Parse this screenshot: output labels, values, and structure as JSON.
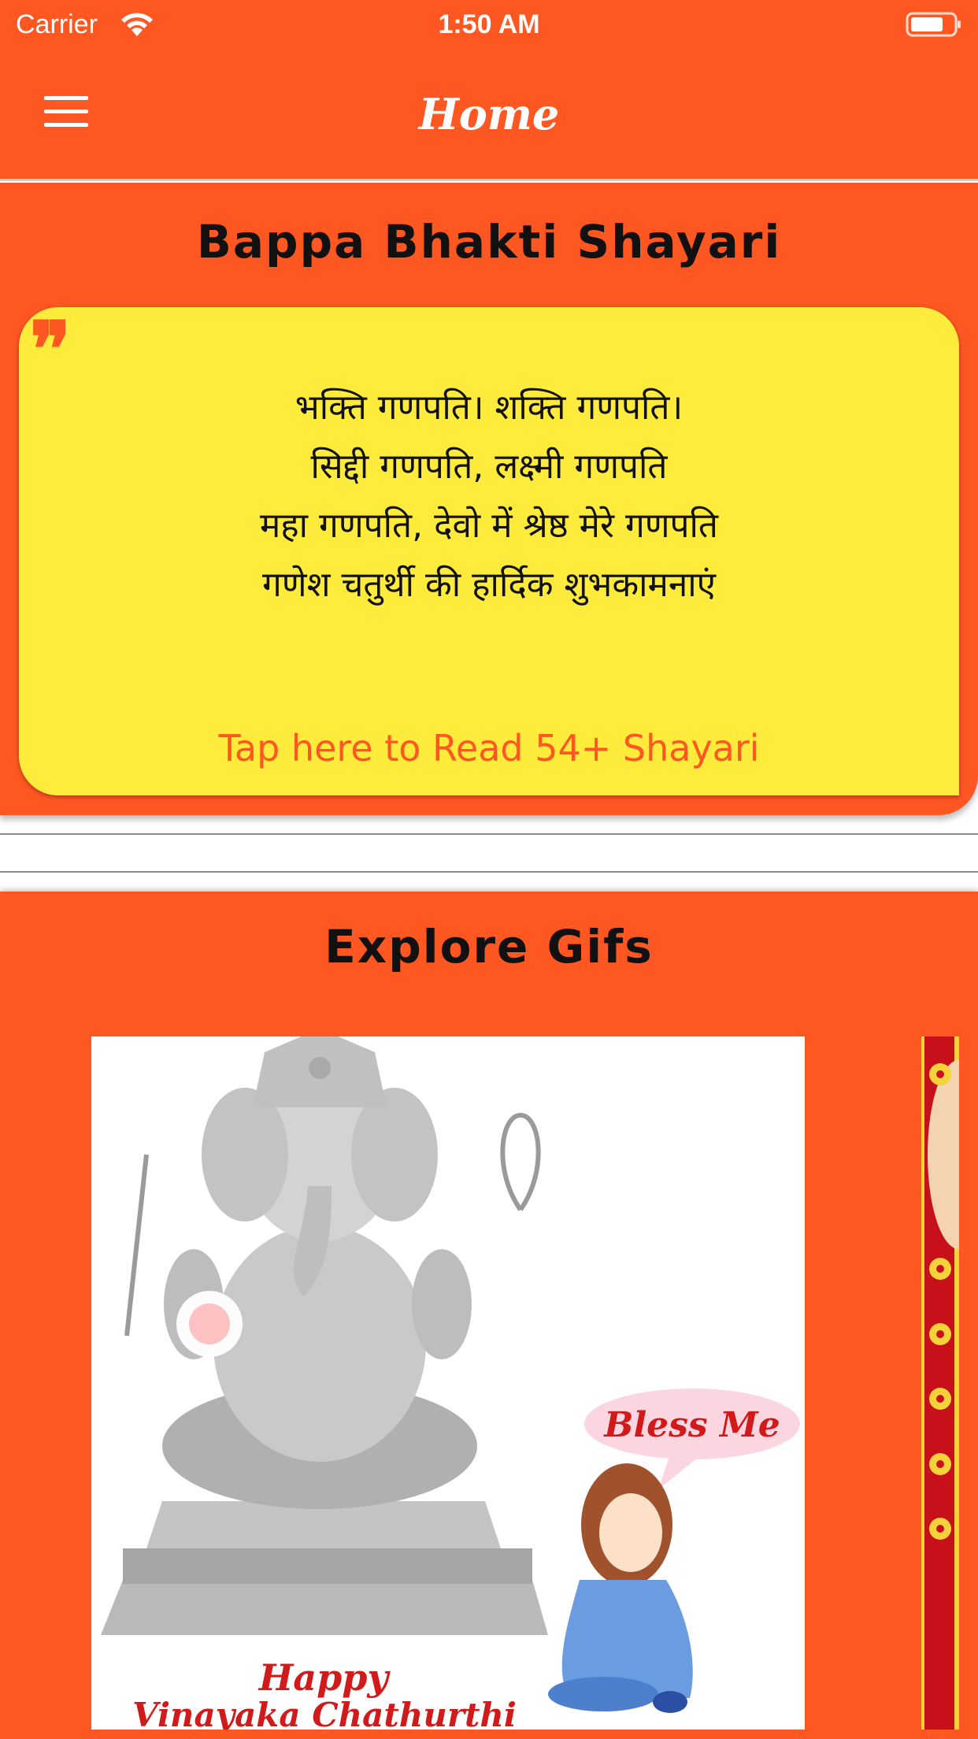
{
  "status_bar": {
    "carrier": "Carrier",
    "time": "1:50 AM",
    "wifi_icon": "wifi-icon",
    "battery_icon": "battery-icon"
  },
  "nav": {
    "menu_icon": "hamburger-menu-icon",
    "title": "Home"
  },
  "shayari": {
    "title": "Bappa Bhakti Shayari",
    "quote_glyph": "❞",
    "lines": [
      "भक्ति गणपति। शक्ति गणपति।",
      "सिद्दी गणपति, लक्ष्मी गणपति",
      "महा गणपति, देवो में श्रेष्ठ मेरे गणपति",
      "गणेश चतुर्थी की हार्दिक शुभकामनाएं"
    ],
    "link_text": "Tap here to Read 54+ Shayari"
  },
  "gifs": {
    "title": "Explore Gifs",
    "items": [
      {
        "speech_bubble": "Bless Me",
        "caption_line1": "Happy",
        "caption_line2": "Vinayaka Chathurthi"
      }
    ]
  },
  "colors": {
    "primary": "#ff5722",
    "card": "#ffeb3b",
    "text": "#111111",
    "white": "#ffffff",
    "caption_red": "#d11a1a",
    "next_card_red": "#c8101a"
  }
}
